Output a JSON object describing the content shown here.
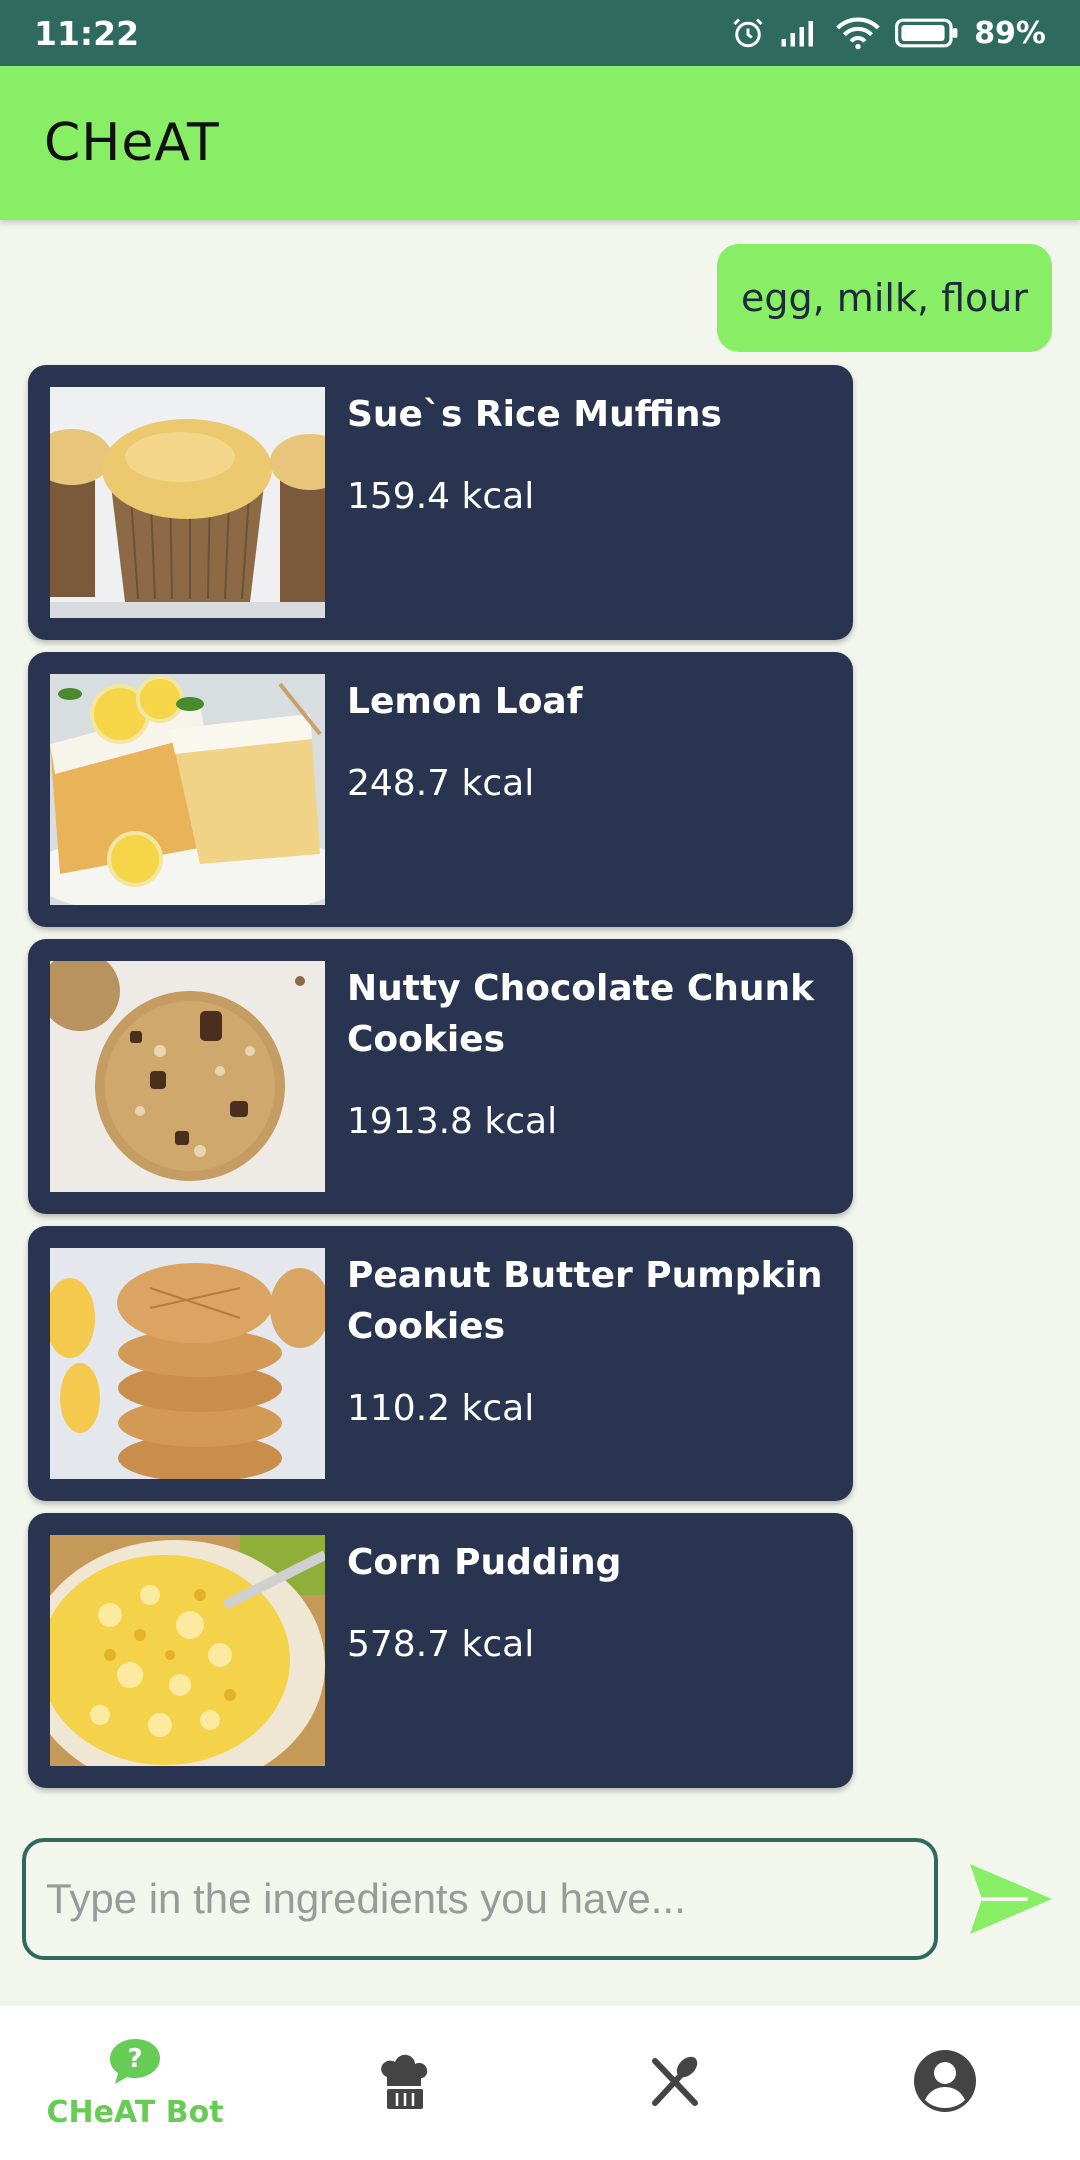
{
  "status_bar": {
    "time": "11:22",
    "battery": "89%",
    "icons": [
      "alarm-icon",
      "signal-icon",
      "wifi-icon",
      "battery-icon"
    ]
  },
  "app_bar": {
    "title": "CHeAT"
  },
  "chat": {
    "user_message": "egg, milk, flour",
    "recipes": [
      {
        "title": "Sue`s Rice Muffins",
        "kcal": "159.4 kcal"
      },
      {
        "title": "Lemon Loaf",
        "kcal": "248.7 kcal"
      },
      {
        "title": "Nutty Chocolate Chunk Cookies",
        "kcal": "1913.8 kcal"
      },
      {
        "title": "Peanut Butter Pumpkin Cookies",
        "kcal": "110.2 kcal"
      },
      {
        "title": "Corn Pudding",
        "kcal": "578.7 kcal"
      }
    ]
  },
  "input": {
    "placeholder": "Type in the ingredients you have...",
    "value": ""
  },
  "bottom_nav": {
    "items": [
      {
        "label": "CHeAT Bot",
        "icon": "chat-question-icon",
        "active": true
      },
      {
        "label": "",
        "icon": "chef-hat-icon",
        "active": false
      },
      {
        "label": "",
        "icon": "utensils-icon",
        "active": false
      },
      {
        "label": "",
        "icon": "account-icon",
        "active": false
      }
    ]
  },
  "colors": {
    "status_bar": "#2e6b5e",
    "accent_green": "#88ee66",
    "card_bg": "#293450",
    "page_bg": "#f3f6ed",
    "nav_active": "#66cc55"
  }
}
